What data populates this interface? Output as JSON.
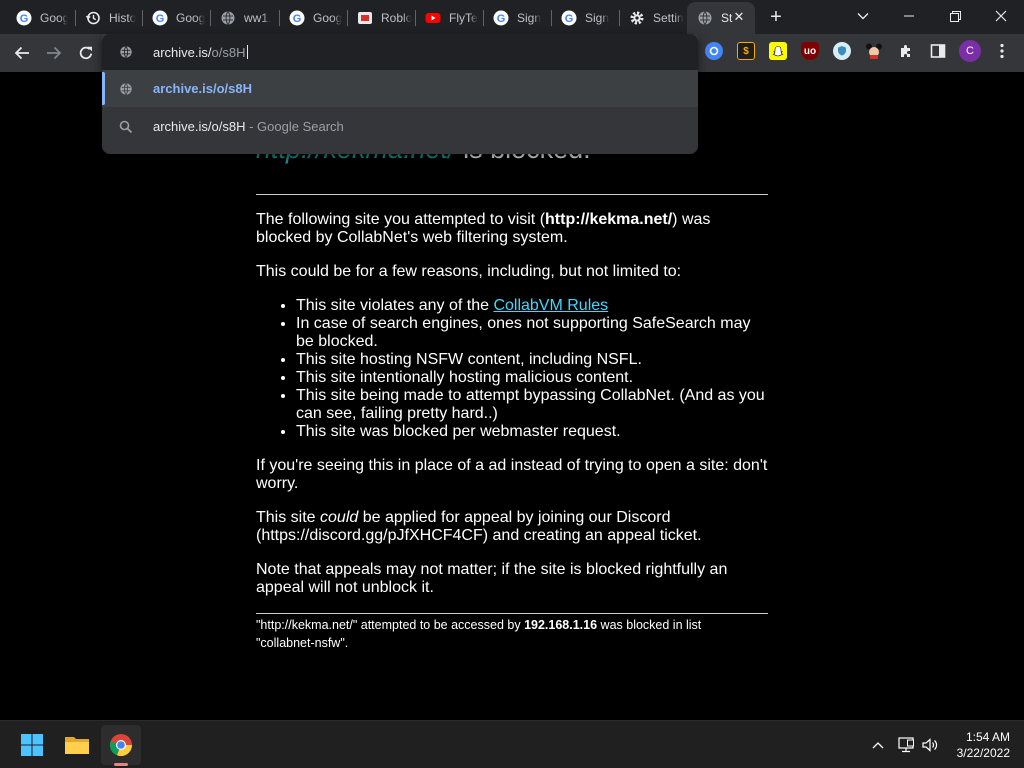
{
  "tabs": [
    {
      "title": "Goog",
      "favicon": "google-icon"
    },
    {
      "title": "Histo",
      "favicon": "history-icon"
    },
    {
      "title": "Goog",
      "favicon": "google-icon"
    },
    {
      "title": "ww1.",
      "favicon": "globe-icon"
    },
    {
      "title": "Goog",
      "favicon": "google-icon"
    },
    {
      "title": "Roblo",
      "favicon": "roblox-icon"
    },
    {
      "title": "FlyTe",
      "favicon": "youtube-icon"
    },
    {
      "title": "Sign",
      "favicon": "google-icon"
    },
    {
      "title": "Sign",
      "favicon": "google-icon"
    },
    {
      "title": "Settin",
      "favicon": "gear-icon"
    },
    {
      "title": "St",
      "favicon": "globe-icon",
      "active": true
    }
  ],
  "omnibox": {
    "typed_text": "archive.is/",
    "autocomplete_text": "o/s8H",
    "suggestions": [
      {
        "icon": "globe-icon",
        "text": "archive.is/o/s8H",
        "suffix": "",
        "selected": true
      },
      {
        "icon": "search-icon",
        "text": "archive.is/o/s8H",
        "suffix": " - Google Search",
        "selected": false
      }
    ]
  },
  "extensions": [
    "google-lens-icon",
    "dollar-extension-icon",
    "snapchat-icon",
    "ublock-origin-icon",
    "shield-extension-icon",
    "mickey-extension-icon",
    "puzzle-extensions-icon",
    "sidebar-icon",
    "profile-avatar-icon",
    "menu-dots-icon"
  ],
  "profile_initial": "C",
  "page": {
    "headline_url": "http://kekma.net/",
    "headline_suffix": " is blocked.",
    "intro_prefix": "The following site you attempted to visit (",
    "intro_url": "http://kekma.net/",
    "intro_suffix": ") was blocked by CollabNet's web filtering system.",
    "reasons_intro": "This could be for a few reasons, including, but not limited to:",
    "reasons": [
      {
        "text": "This site violates any of the ",
        "link": "CollabVM Rules"
      },
      {
        "text": "In case of search engines, ones not supporting SafeSearch may be blocked.",
        "link": ""
      },
      {
        "text": "This site hosting NSFW content, including NSFL.",
        "link": ""
      },
      {
        "text": "This site intentionally hosting malicious content.",
        "link": ""
      },
      {
        "text": "This site being made to attempt bypassing CollabNet. (And as you can see, failing pretty hard..)",
        "link": ""
      },
      {
        "text": "This site was blocked per webmaster request.",
        "link": ""
      }
    ],
    "ad_note": "If you're seeing this in place of a ad instead of trying to open a site: don't worry.",
    "appeal_prefix": "This site ",
    "appeal_em": "could",
    "appeal_suffix": " be applied for appeal by joining our Discord (https://discord.gg/pJfXHCF4CF) and creating an appeal ticket.",
    "appeal_note": "Note that appeals may not matter; if the site is blocked rightfully an appeal will not unblock it.",
    "footer_prefix": "\"http://kekma.net/\" attempted to be accessed by ",
    "footer_ip": "192.168.1.16",
    "footer_middle": " was blocked in list",
    "footer_list": "\"collabnet-nsfw\"."
  },
  "taskbar": {
    "apps": [
      "windows-start-icon",
      "file-explorer-icon",
      "chrome-icon"
    ],
    "time": "1:54 AM",
    "date": "3/22/2022"
  },
  "colors": {
    "headline_url": "#17a2a2",
    "link": "#3fd8ff",
    "omnibox_selected": "#8ab4f8"
  }
}
